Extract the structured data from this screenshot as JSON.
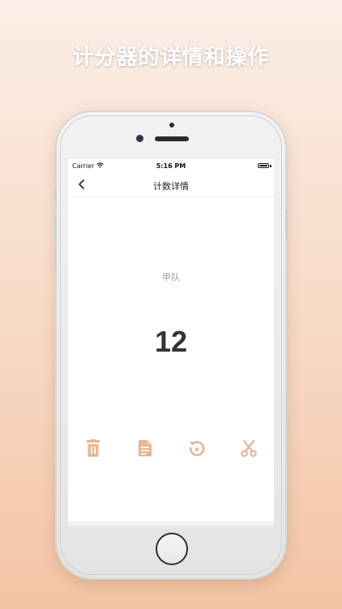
{
  "headline": "计分器的详情和操作",
  "status_bar": {
    "carrier": "Carrier",
    "time": "5:16 PM"
  },
  "nav": {
    "title": "计数详情",
    "back_icon": "chevron-left-icon"
  },
  "counter": {
    "team_name": "甲队",
    "value": "12"
  },
  "toolbar": {
    "icon_color": "#e9b58e",
    "buttons": [
      {
        "name": "delete",
        "icon": "trash-icon"
      },
      {
        "name": "record",
        "icon": "document-icon"
      },
      {
        "name": "reset",
        "icon": "reset-icon"
      },
      {
        "name": "cut",
        "icon": "scissors-icon"
      }
    ]
  },
  "colors": {
    "accent": "#e9b58e",
    "background_top": "#fbeee6",
    "background_bottom": "#f3c4a4",
    "value_text": "#333333",
    "team_text": "#9a9a9a"
  }
}
